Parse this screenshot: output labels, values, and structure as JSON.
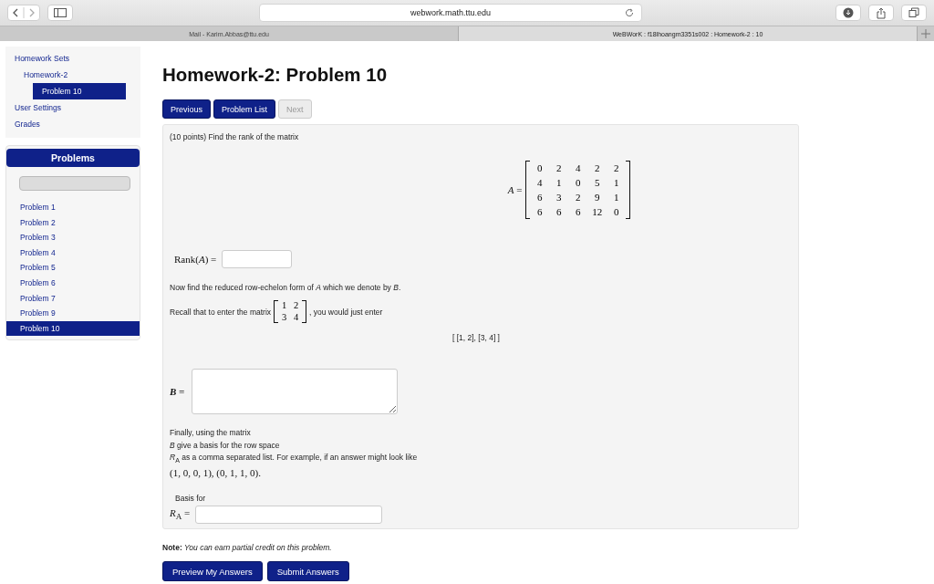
{
  "browser": {
    "url": "webwork.math.ttu.edu",
    "tabs": [
      {
        "label": "Mail - Karim.Abbas@ttu.edu",
        "selected": false
      },
      {
        "label": "WeBWorK : f18lhoangm3351s002 : Homework-2 : 10",
        "selected": true
      }
    ]
  },
  "sidebar": {
    "nav": [
      {
        "label": "Homework Sets",
        "selected": false,
        "children": [
          {
            "label": "Homework-2",
            "selected": false,
            "children": [
              {
                "label": "Problem 10",
                "selected": true
              }
            ]
          }
        ]
      },
      {
        "label": "User Settings",
        "selected": false
      },
      {
        "label": "Grades",
        "selected": false
      }
    ],
    "problems": {
      "title": "Problems",
      "items": [
        {
          "label": "Problem 1",
          "selected": false
        },
        {
          "label": "Problem 2",
          "selected": false
        },
        {
          "label": "Problem 3",
          "selected": false
        },
        {
          "label": "Problem 4",
          "selected": false
        },
        {
          "label": "Problem 5",
          "selected": false
        },
        {
          "label": "Problem 6",
          "selected": false
        },
        {
          "label": "Problem 7",
          "selected": false
        },
        {
          "label": "Problem 9",
          "selected": false
        },
        {
          "label": "Problem 10",
          "selected": true
        }
      ]
    }
  },
  "heading": "Homework-2: Problem 10",
  "nav_buttons": [
    {
      "label": "Previous",
      "disabled": false
    },
    {
      "label": "Problem List",
      "disabled": false
    },
    {
      "label": "Next",
      "disabled": true
    }
  ],
  "problem": {
    "intro": "(10 points) Find the rank of the matrix",
    "matrix_label": "*A* =",
    "matrix": [
      [
        "0",
        "2",
        "4",
        "2",
        "2"
      ],
      [
        "4",
        "1",
        "0",
        "5",
        "1"
      ],
      [
        "6",
        "3",
        "2",
        "9",
        "1"
      ],
      [
        "6",
        "6",
        "6",
        "12",
        "0"
      ]
    ],
    "rank_label": "Rank(*A*) =",
    "rref_text": "Now find the reduced row-echelon form of *A* which we denote by *B*.",
    "recall_before": "Recall that to enter the matrix",
    "example_matrix": [
      [
        "1",
        "2"
      ],
      [
        "3",
        "4"
      ]
    ],
    "recall_after": ", you would just enter",
    "example_entry": "[ [1, 2], [3, 4] ]",
    "b_label": "*B* =",
    "final_lines": [
      "Finally, using the matrix",
      "*B* give a basis for the row space",
      "*R*$_{A}$ as a comma separated list. For example, if an answer might look like"
    ],
    "example_answer": "(1, 0, 0, 1), (0, 1, 1, 0).",
    "basis_label": "Basis for",
    "ra_label": "*R*$_{A}$ ="
  },
  "note": "**Note:** *You can earn partial credit on this problem.*",
  "submit_buttons": [
    "Preview My Answers",
    "Submit Answers"
  ]
}
